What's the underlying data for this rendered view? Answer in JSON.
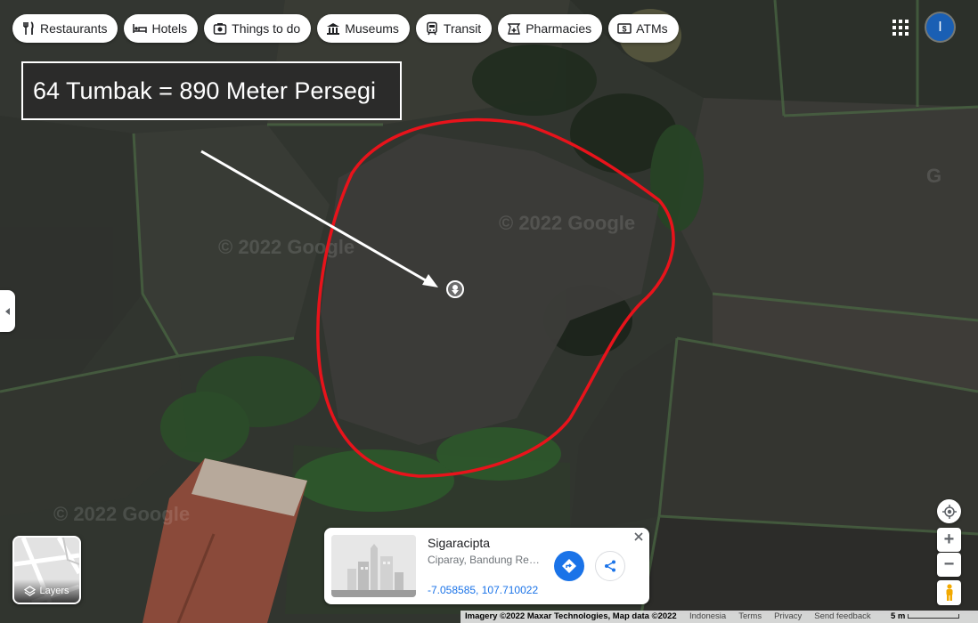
{
  "map": {
    "type": "satellite",
    "watermark": "© 2022 Google",
    "boundary_color": "#e8131b",
    "arrow_color": "#ffffff"
  },
  "categories": [
    {
      "label": "Restaurants",
      "icon": "restaurant-icon"
    },
    {
      "label": "Hotels",
      "icon": "hotel-icon"
    },
    {
      "label": "Things to do",
      "icon": "camera-icon"
    },
    {
      "label": "Museums",
      "icon": "museum-icon"
    },
    {
      "label": "Transit",
      "icon": "train-icon"
    },
    {
      "label": "Pharmacies",
      "icon": "pharmacy-icon"
    },
    {
      "label": "ATMs",
      "icon": "atm-icon"
    }
  ],
  "account": {
    "initial": "I",
    "color": "#1a5fb4"
  },
  "annotation": {
    "text": "64 Tumbak = 890 Meter Persegi"
  },
  "layers": {
    "label": "Layers"
  },
  "place_card": {
    "name": "Sigaracipta",
    "address": "Ciparay, Bandung Regency, West Java",
    "coordinates": "-7.058585, 107.710022"
  },
  "controls": {
    "zoom_in": "+",
    "zoom_out": "−"
  },
  "footer": {
    "attribution": "Imagery ©2022 Maxar Technologies, Map data ©2022",
    "links": [
      "Indonesia",
      "Terms",
      "Privacy",
      "Send feedback"
    ],
    "scale": "5 m"
  }
}
